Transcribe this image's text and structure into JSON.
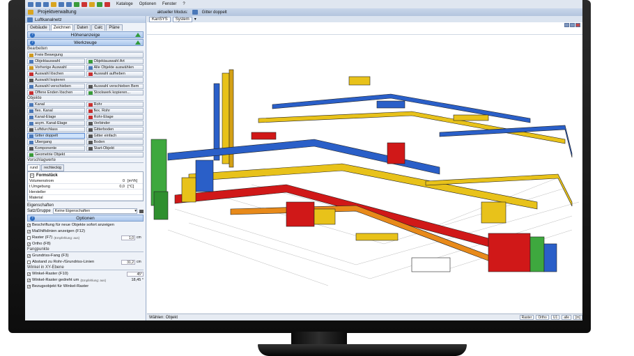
{
  "toolbar": {
    "menu": [
      "Kataloge",
      "Optionen",
      "Fenster",
      "?"
    ]
  },
  "title_bar": {
    "project": "Projektverwaltung",
    "mode_label": "aktueller Modus:",
    "mode_value": "Gitter doppelt"
  },
  "left_panel": {
    "title": "Luftkanalnetz",
    "tabs": [
      "Gebäude",
      "Zeichnen",
      "Daten",
      "Calc",
      "Pläne"
    ],
    "active_tab": "Zeichnen",
    "header_rows": [
      "Höhenanzeige",
      "Werkzeuge"
    ],
    "bearbeiten": {
      "label": "Bearbeiten",
      "buttons": [
        "Freie Bewegung",
        "Objektauswahl",
        "Objektauswahl Art",
        "Vorherige Auswahl",
        "Alle Objekte auswählen",
        "Auswahl löschen",
        "Auswahl aufheben",
        "Auswahl kopieren",
        "Auswahl verschieben",
        "Auswahl verschieben Bem",
        "Offene Enden löschen",
        "Stockwerk kopieren..."
      ]
    },
    "objekte": {
      "label": "Objekte",
      "buttons": [
        "Kanal",
        "Rohr",
        "flex. Kanal",
        "flex. Rohr",
        "Kanal-Etage",
        "Rohr-Etage",
        "asym. Kanal-Etage",
        "Verbinder",
        "Luftdurchlass",
        "Gitterboden",
        "Gitter doppelt",
        "Gitter einfach",
        "Übergang",
        "Boden",
        "Komponente",
        "Start-Objekt",
        "Geometrie Objekt"
      ],
      "selected": "Gitter doppelt"
    },
    "vorschlagswerte": {
      "label": "Vorschlagwerte",
      "tabs": [
        "rund",
        "rechteckig"
      ],
      "group": "Formstück",
      "rows": [
        {
          "name": "Volumenstrom",
          "value": "0",
          "unit": "[m³/h]"
        },
        {
          "name": "t Umgebung",
          "value": "0,0",
          "unit": "[°C]"
        },
        {
          "name": "Hersteller",
          "value": "",
          "unit": ""
        },
        {
          "name": "Material",
          "value": "",
          "unit": ""
        }
      ]
    },
    "eigenschaften": {
      "label": "Eigenschaften",
      "row_label": "Satz/Gruppe",
      "value": "Keine Eigenschaften"
    },
    "optionen": {
      "header": "Optionen",
      "checks": [
        {
          "label": "Beschriftung für neue Objekte sofort anzeigen",
          "checked": true
        },
        {
          "label": "Maßhilfslinien anzeigen (F12)",
          "checked": true
        },
        {
          "label": "Raster (F7)",
          "note": "(Empfehlung: aus)",
          "checked": false,
          "value": "1,0",
          "unit": "cm"
        },
        {
          "label": "Ortho (F8)",
          "checked": true
        }
      ],
      "fangpunkte_label": "Fangpunkte",
      "fang_checks": [
        {
          "label": "Grundriss-Fang (F3)",
          "checked": true
        },
        {
          "label": "Abstand zu Rohr-/Grundriss-Linien",
          "checked": false,
          "value": "31,2",
          "unit": "cm"
        }
      ],
      "winkel_label": "Winkel in XY-Ebene",
      "winkel_checks": [
        {
          "label": "Winkel-Raster (F10)",
          "checked": true,
          "value": "45°"
        },
        {
          "label": "Winkel-Raster gedreht um",
          "note": "(Empfehlung: aus)",
          "checked": true,
          "value": "18,45 °"
        },
        {
          "label": "Bezugsobjekt für Winkel-Raster",
          "checked": true
        }
      ]
    }
  },
  "canvas": {
    "tabs": [
      "KanSYS",
      "System"
    ],
    "status_left": "Wählen: Objekt",
    "status_right": [
      "Raster",
      "Ortho",
      "U1",
      "alle",
      "[m]"
    ]
  },
  "colors": {
    "duct_blue": "#2a5fc8",
    "duct_yellow": "#e8c21a",
    "duct_red": "#d01818",
    "duct_green": "#3ea83e",
    "duct_orange": "#e88a1a"
  }
}
